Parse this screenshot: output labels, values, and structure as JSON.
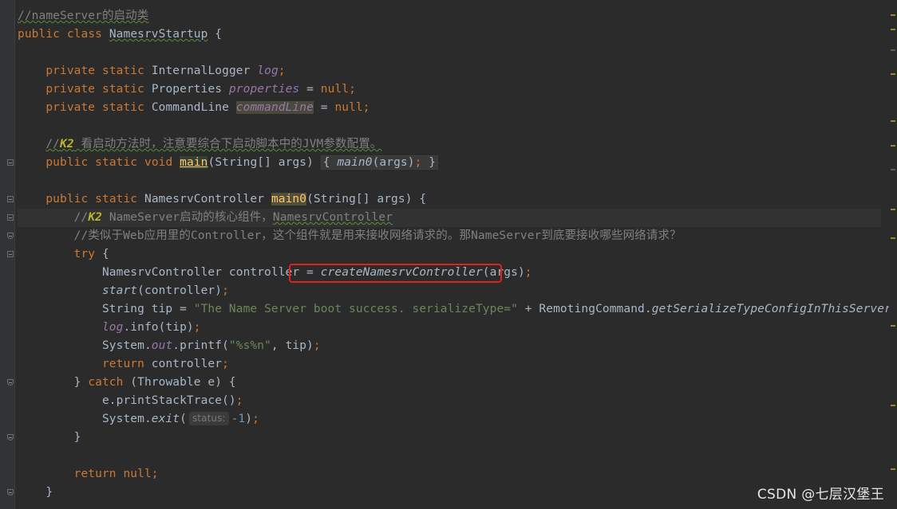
{
  "colors": {
    "background": "#2b2b2b",
    "keyword": "#cc7832",
    "comment": "#808080",
    "todo_tag": "#bbb529",
    "field": "#9876aa",
    "string": "#6a8759",
    "number": "#6897bb",
    "method_declaration": "#ffc66d",
    "highlight_box": "#e0211e"
  },
  "code": {
    "l1_comment": "//nameServer的启动类",
    "l2_public": "public",
    "l2_class": "class",
    "l2_name": "NamesrvStartup",
    "l2_brace": " {",
    "l4_private": "private",
    "l4_static": "static",
    "l4_type": "InternalLogger",
    "l4_var": "log",
    "l4_semi": ";",
    "l5_private": "private",
    "l5_static": "static",
    "l5_type": "Properties",
    "l5_var": "properties",
    "l5_eq": " = ",
    "l5_null": "null",
    "l5_semi": ";",
    "l6_private": "private",
    "l6_static": "static",
    "l6_type": "CommandLine",
    "l6_var": "commandLine",
    "l6_eq": " = ",
    "l6_null": "null",
    "l6_semi": ";",
    "l8_prefix": "//",
    "l8_tag": "K2",
    "l8_text": " 看启动方法时，注意要综合下启动脚本中的JVM参数配置。",
    "l9_public": "public",
    "l9_static": "static",
    "l9_void": "void",
    "l9_main": "main",
    "l9_params": "(String[] args) ",
    "l9_body_open": "{ ",
    "l9_call": "main0",
    "l9_call_args": "(args)",
    "l9_semi": ";",
    "l9_body_close": " }",
    "l11_public": "public",
    "l11_static": "static",
    "l11_type": "NamesrvController",
    "l11_name": "main0",
    "l11_params": "(String[] args) {",
    "l12_prefix": "//",
    "l12_tag": "K2",
    "l12_text": " NameServer启动的核心组件，",
    "l12_text2": "NamesrvController",
    "l13_comment": "//类似于Web应用里的Controller，这个组件就是用来接收网络请求的。那NameServer到底要接收哪些网络请求？",
    "l14_try": "try",
    "l14_brace": " {",
    "l15_decl": "NamesrvController controller = ",
    "l15_call": "createNamesrvController",
    "l15_args": "(args)",
    "l15_semi": ";",
    "l16_call": "start",
    "l16_args": "(controller)",
    "l16_semi": ";",
    "l17_decl": "String tip = ",
    "l17_str": "\"The Name Server boot success. serializeType=\"",
    "l17_plus": " + RemotingCommand.",
    "l17_call": "getSerializeTypeConfigInThisServer",
    "l17_end": "()",
    "l17_semi": ";",
    "l18_log": "log",
    "l18_rest": ".info(tip)",
    "l18_semi": ";",
    "l19_sys": "System.",
    "l19_out": "out",
    "l19_printf": ".printf(",
    "l19_str": "\"%s%n\"",
    "l19_rest": ", tip)",
    "l19_semi": ";",
    "l20_return": "return",
    "l20_rest": " controller",
    "l20_semi": ";",
    "l21_close": "} ",
    "l21_catch": "catch",
    "l21_rest": " (Throwable e) {",
    "l22_text": "e.printStackTrace()",
    "l22_semi": ";",
    "l23_sys": "System.",
    "l23_exit": "exit",
    "l23_open": "(",
    "l23_hint": "status:",
    "l23_num": "-1",
    "l23_close": ")",
    "l23_semi": ";",
    "l24_close": "}",
    "l26_return": "return",
    "l26_null": "null",
    "l26_semi": ";",
    "l27_close": "}"
  },
  "watermark": "CSDN @七层汉堡王"
}
